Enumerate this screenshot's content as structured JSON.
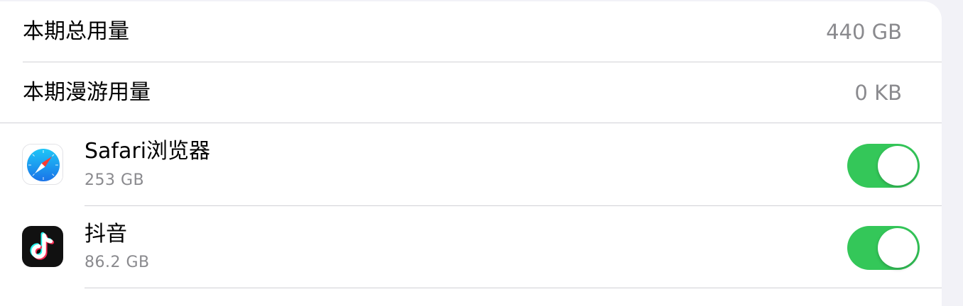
{
  "usage": {
    "total_label": "本期总用量",
    "total_value": "440 GB",
    "roaming_label": "本期漫游用量",
    "roaming_value": "0 KB"
  },
  "apps": [
    {
      "name": "Safari浏览器",
      "size": "253 GB",
      "icon": "safari-compass-icon",
      "cellular_enabled": true
    },
    {
      "name": "抖音",
      "size": "86.2 GB",
      "icon": "tiktok-note-icon",
      "cellular_enabled": true
    }
  ],
  "colors": {
    "toggle_on": "#34c759",
    "secondary_text": "#8a8a8e",
    "separator": "#d1d1d6",
    "background": "#f2f2f7"
  }
}
